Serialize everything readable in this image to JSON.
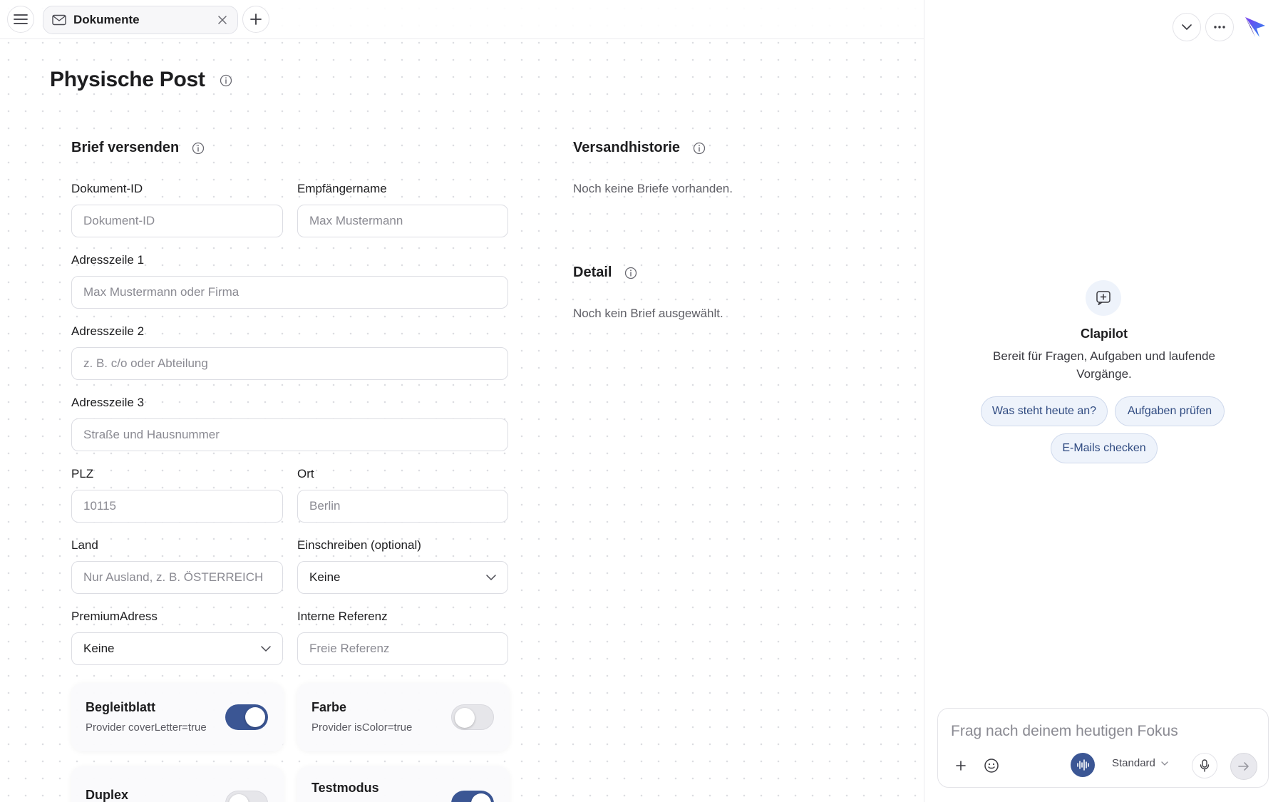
{
  "tabbar": {
    "tab_label": "Dokumente"
  },
  "page": {
    "title": "Physische Post"
  },
  "form": {
    "title": "Brief versenden",
    "fields": {
      "dokument_id": {
        "label": "Dokument-ID",
        "placeholder": "Dokument-ID",
        "value": ""
      },
      "empfaengername": {
        "label": "Empfängername",
        "placeholder": "Max Mustermann",
        "value": ""
      },
      "adresszeile1": {
        "label": "Adresszeile 1",
        "placeholder": "Max Mustermann oder Firma",
        "value": ""
      },
      "adresszeile2": {
        "label": "Adresszeile 2",
        "placeholder": "z. B. c/o oder Abteilung",
        "value": ""
      },
      "adresszeile3": {
        "label": "Adresszeile 3",
        "placeholder": "Straße und Hausnummer",
        "value": ""
      },
      "plz": {
        "label": "PLZ",
        "placeholder": "10115",
        "value": ""
      },
      "ort": {
        "label": "Ort",
        "placeholder": "Berlin",
        "value": ""
      },
      "land": {
        "label": "Land",
        "placeholder": "Nur Ausland, z. B. ÖSTERREICH",
        "value": ""
      },
      "einschreiben": {
        "label": "Einschreiben (optional)",
        "value": "Keine"
      },
      "premiumadress": {
        "label": "PremiumAdress",
        "value": "Keine"
      },
      "interne_referenz": {
        "label": "Interne Referenz",
        "placeholder": "Freie Referenz",
        "value": ""
      }
    },
    "toggles": {
      "begleitblatt": {
        "title": "Begleitblatt",
        "sub": "Provider coverLetter=true",
        "on": true
      },
      "farbe": {
        "title": "Farbe",
        "sub": "Provider isColor=true",
        "on": false
      },
      "duplex": {
        "title": "Duplex",
        "on": false
      },
      "testmodus": {
        "title": "Testmodus",
        "on": true
      }
    }
  },
  "history": {
    "title": "Versandhistorie",
    "empty": "Noch keine Briefe vorhanden."
  },
  "detail": {
    "title": "Detail",
    "empty": "Noch kein Brief ausgewählt."
  },
  "assistant": {
    "name": "Clapilot",
    "description": "Bereit für Fragen, Aufgaben und laufende Vorgänge.",
    "chips": [
      "Was steht heute an?",
      "Aufgaben prüfen",
      "E-Mails checken"
    ],
    "composer_placeholder": "Frag nach deinem heutigen Fokus",
    "mode": "Standard"
  },
  "colors": {
    "accent": "#3b5694",
    "chip_bg": "#eef3fb",
    "chip_text": "#2f4a80"
  },
  "icons": [
    "menu-icon",
    "mail-icon",
    "close-icon",
    "plus-icon",
    "info-icon",
    "chevron-down-icon",
    "more-icon",
    "app-logo",
    "chat-plus-icon",
    "emoji-icon",
    "voice-wave-icon",
    "microphone-icon",
    "send-arrow-icon"
  ]
}
